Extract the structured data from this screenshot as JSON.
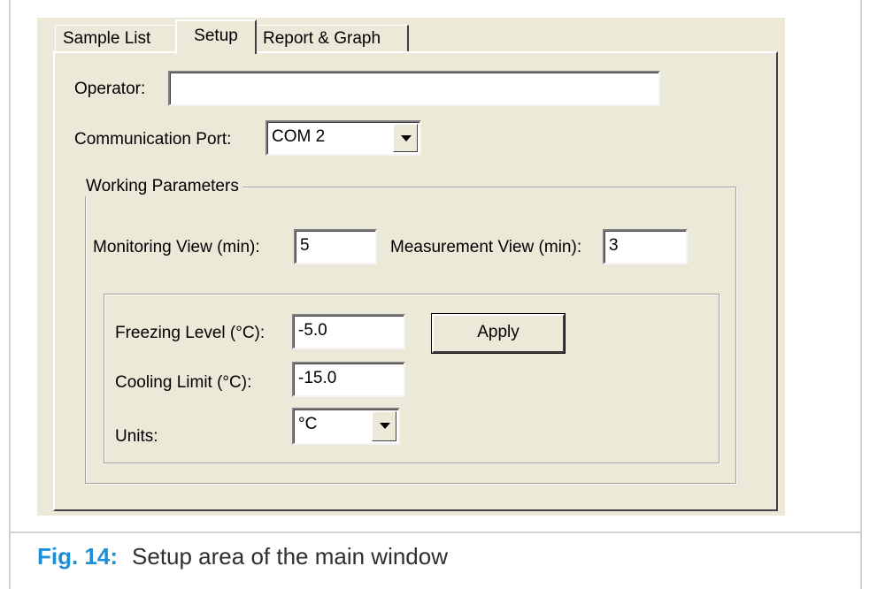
{
  "tabs": [
    "Sample List",
    "Setup",
    "Report & Graph"
  ],
  "operator": {
    "label": "Operator:",
    "value": ""
  },
  "comm_port": {
    "label": "Communication Port:",
    "value": "COM 2"
  },
  "working_params": {
    "title": "Working Parameters",
    "monitoring": {
      "label": "Monitoring View (min):",
      "value": "5"
    },
    "measurement": {
      "label": "Measurement View (min):",
      "value": "3"
    }
  },
  "inner": {
    "freezing": {
      "label": "Freezing Level (°C):",
      "value": "-5.0"
    },
    "cooling": {
      "label": "Cooling Limit (°C):",
      "value": "-15.0"
    },
    "units": {
      "label": "Units:",
      "value": "°C"
    },
    "apply_label": "Apply"
  },
  "caption": {
    "number": "Fig. 14:",
    "text": "Setup area of the main window"
  },
  "colors": {
    "caption_accent": "#1e8fd6",
    "window_bg": "#ece9d8"
  }
}
